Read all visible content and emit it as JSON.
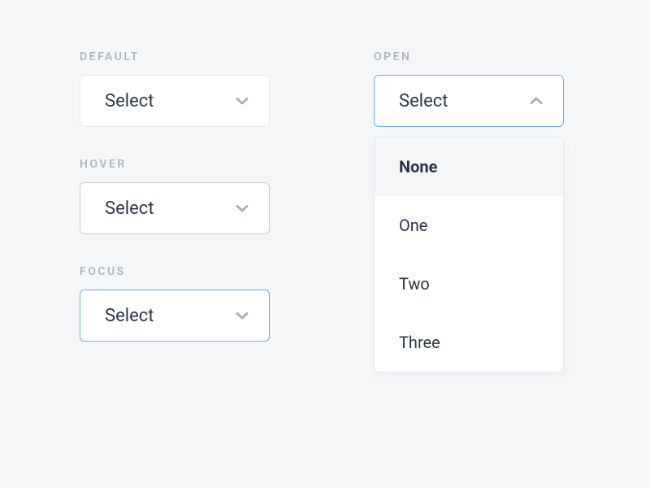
{
  "left": {
    "default": {
      "label": "DEFAULT",
      "value": "Select"
    },
    "hover": {
      "label": "HOVER",
      "value": "Select"
    },
    "focus": {
      "label": "FOCUS",
      "value": "Select"
    }
  },
  "right": {
    "open": {
      "label": "OPEN",
      "value": "Select",
      "options": [
        "None",
        "One",
        "Two",
        "Three"
      ],
      "selected": "None"
    }
  }
}
